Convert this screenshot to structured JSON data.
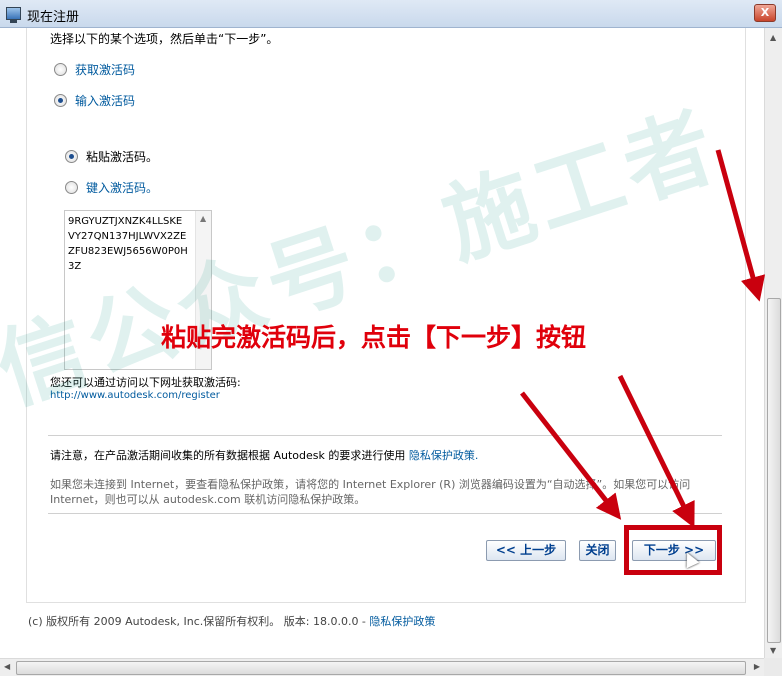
{
  "window": {
    "title": "现在注册",
    "close_label": "X"
  },
  "main": {
    "instruction": "选择以下的某个选项，然后单击“下一步”。",
    "options": [
      {
        "label": "获取激活码",
        "checked": false
      },
      {
        "label": "输入激活码",
        "checked": true
      }
    ],
    "sub_options": [
      {
        "label": "粘贴激活码。",
        "checked": true
      },
      {
        "label": "键入激活码。",
        "checked": false
      }
    ],
    "activation_code": "9RGYUZTJXNZK4LLSKE\nVY27QN137HJLWVX2ZE\nZFU823EWJ5656W0P0H\n3Z",
    "note": "您还可以通过访问以下网址获取激活码:",
    "url": "http://www.autodesk.com/register",
    "privacy_line1": "请注意，在产品激活期间收集的所有数据根据 Autodesk 的要求进行使用",
    "privacy_link": "隐私保护政策.",
    "privacy_line2": "如果您未连接到 Internet，要查看隐私保护政策，请将您的 Internet Explorer (R) 浏览器编码设置为“自动选择”。如果您可以访问 Internet，则也可以从 autodesk.com 联机访问隐私保护政策。"
  },
  "buttons": {
    "back": "<< 上一步",
    "close": "关闭",
    "next": "下一步 >>"
  },
  "footer": {
    "copyright": "(c) 版权所有 2009 Autodesk, Inc.保留所有权利。 版本: 18.0.0.0 -",
    "privacy_link": "隐私保护政策"
  },
  "overlay": {
    "annotation": "粘贴完激活码后，点击【下一步】按钮",
    "watermark": "信公众号：施工者",
    "accent_color": "#e0000b"
  },
  "icons": [
    "window-icon",
    "close-icon",
    "mouse-cursor-icon",
    "red-arrow-icon"
  ]
}
